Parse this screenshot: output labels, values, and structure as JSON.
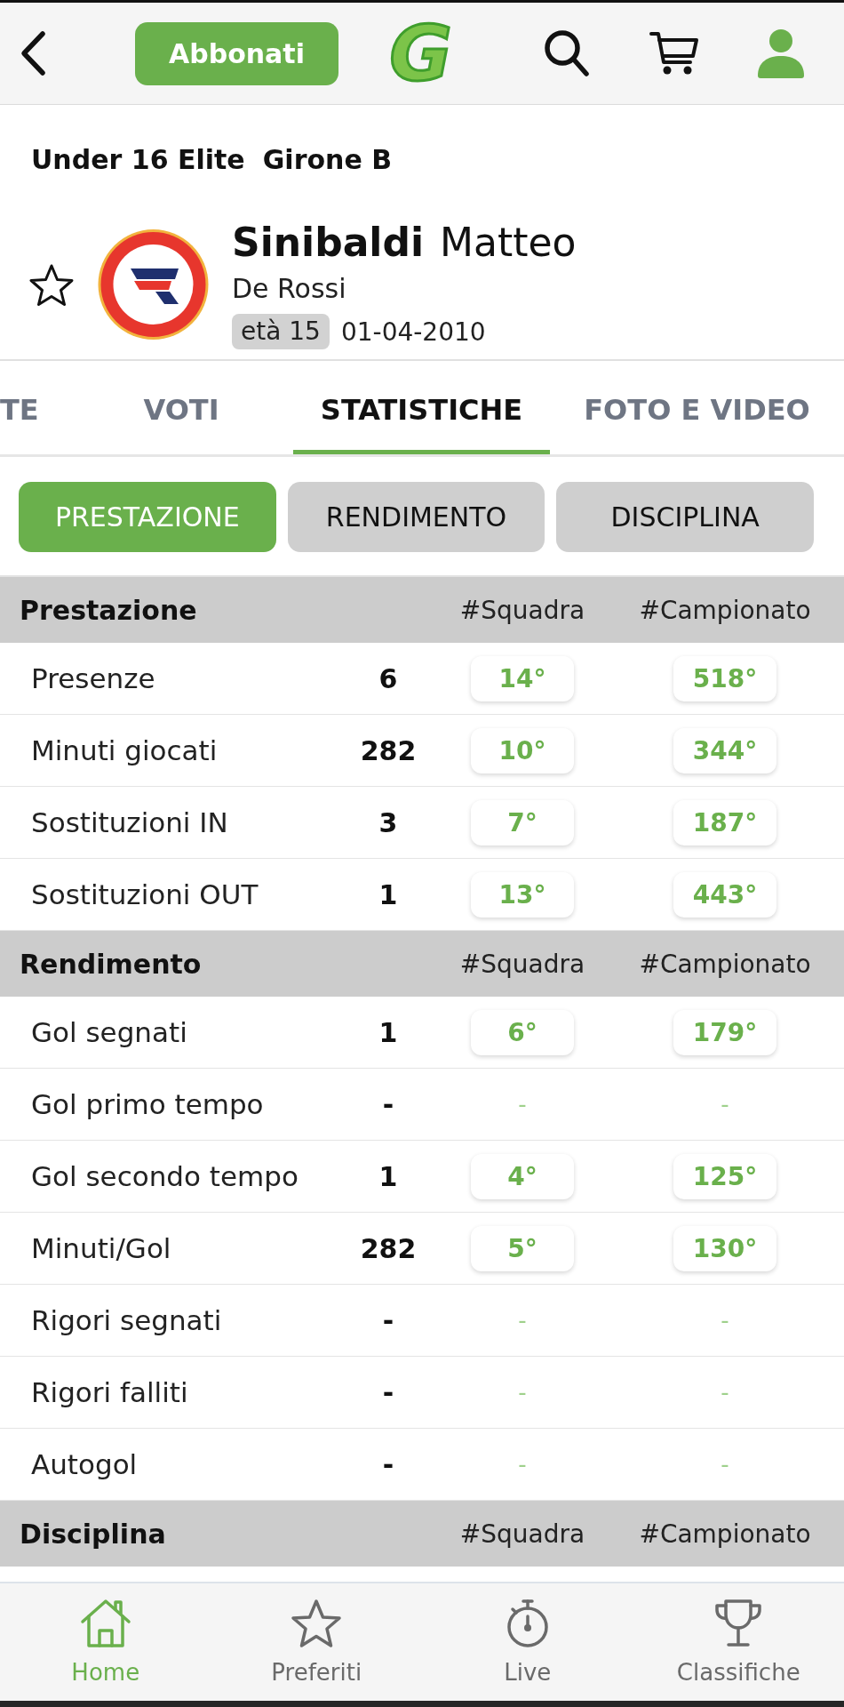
{
  "top_bar": {
    "subscribe_button": "Abbonati",
    "logo": "G"
  },
  "competition": {
    "category": "Under 16 Elite",
    "group": "Girone B"
  },
  "player": {
    "surname": "Sinibaldi",
    "first_name": "Matteo",
    "team": "De Rossi",
    "age": "età 15",
    "birth_date": "01-04-2010",
    "favorite": false
  },
  "tabs": [
    {
      "label": "TE",
      "selected": false
    },
    {
      "label": "VOTI",
      "selected": false
    },
    {
      "label": "STATISTICHE",
      "selected": true
    },
    {
      "label": "FOTO E VIDEO",
      "selected": false
    }
  ],
  "filters": [
    {
      "label": "PRESTAZIONE",
      "selected": true
    },
    {
      "label": "RENDIMENTO",
      "selected": false
    },
    {
      "label": "DISCIPLINA",
      "selected": false
    }
  ],
  "sections": [
    {
      "title": "Prestazione",
      "team_column": "#Squadra",
      "league_column": "#Campionato",
      "rows": [
        {
          "label": "Presenze",
          "value": "6",
          "team_rank": "14°",
          "league_rank": "518°",
          "kind": "ranked"
        },
        {
          "label": "Minuti giocati",
          "value": "282",
          "team_rank": "10°",
          "league_rank": "344°",
          "kind": "ranked"
        },
        {
          "label": "Sostituzioni IN",
          "value": "3",
          "team_rank": "7°",
          "league_rank": "187°",
          "kind": "ranked"
        },
        {
          "label": "Sostituzioni OUT",
          "value": "1",
          "team_rank": "13°",
          "league_rank": "443°",
          "kind": "ranked"
        }
      ]
    },
    {
      "title": "Rendimento",
      "team_column": "#Squadra",
      "league_column": "#Campionato",
      "rows": [
        {
          "label": "Gol segnati",
          "value": "1",
          "team_rank": "6°",
          "league_rank": "179°",
          "kind": "ranked"
        },
        {
          "label": "Gol primo tempo",
          "value": "-",
          "team_rank": "-",
          "league_rank": "-",
          "kind": "unranked"
        },
        {
          "label": "Gol secondo tempo",
          "value": "1",
          "team_rank": "4°",
          "league_rank": "125°",
          "kind": "ranked"
        },
        {
          "label": "Minuti/Gol",
          "value": "282",
          "team_rank": "5°",
          "league_rank": "130°",
          "kind": "ranked"
        },
        {
          "label": "Rigori segnati",
          "value": "-",
          "team_rank": "-",
          "league_rank": "-",
          "kind": "unranked"
        },
        {
          "label": "Rigori falliti",
          "value": "-",
          "team_rank": "-",
          "league_rank": "-",
          "kind": "unranked"
        },
        {
          "label": "Autogol",
          "value": "-",
          "team_rank": "-",
          "league_rank": "-",
          "kind": "unranked"
        }
      ]
    },
    {
      "title": "Disciplina",
      "team_column": "#Squadra",
      "league_column": "#Campionato"
    }
  ],
  "bottom_nav": [
    {
      "label": "Home",
      "selected": true
    },
    {
      "label": "Preferiti",
      "selected": false
    },
    {
      "label": "Live",
      "selected": false
    },
    {
      "label": "Classifiche",
      "selected": false
    }
  ]
}
